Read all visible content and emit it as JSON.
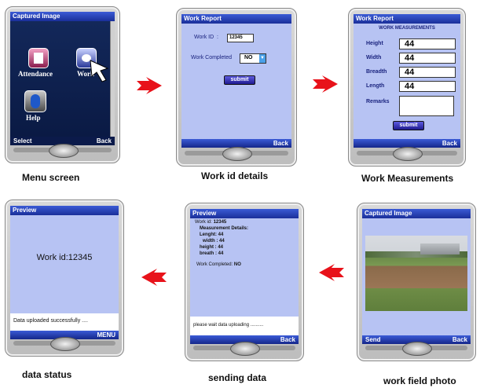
{
  "captions": {
    "menu": "Menu screen",
    "workid": "Work id details",
    "measure": "Work Measurements",
    "status": "data status",
    "sending": "sending data",
    "photo": "work field photo"
  },
  "menu_screen": {
    "title": "Captured Image",
    "items": [
      "Attendance",
      "Work",
      "Help"
    ],
    "left_softkey": "Select",
    "right_softkey": "Back"
  },
  "workid_screen": {
    "title": "Work Report",
    "work_id_label": "Work ID",
    "work_id_sep": ":",
    "work_id_value": "12345",
    "completed_label": "Work Completed",
    "completed_value": "NO",
    "submit": "submit",
    "right_softkey": "Back"
  },
  "measure_screen": {
    "title": "Work Report",
    "heading": "WORK MEASUREMENTS",
    "fields": [
      {
        "label": "Height",
        "value": "44"
      },
      {
        "label": "Width",
        "value": "44"
      },
      {
        "label": "Breadth",
        "value": "44"
      },
      {
        "label": "Length",
        "value": "44"
      }
    ],
    "remarks_label": "Remarks",
    "submit": "submit",
    "right_softkey": "Back"
  },
  "status_screen": {
    "title": "Preview",
    "work_id_text": "Work id:12345",
    "message": "Data uploaded successfully ....",
    "right_softkey": "MENU"
  },
  "sending_screen": {
    "title": "Preview",
    "work_id_label": "Work id:",
    "work_id_value": "12345",
    "details_heading": "Measurement Details:",
    "details": [
      "Lenght: 44",
      "width : 44",
      "height : 44",
      "breath : 44"
    ],
    "completed_label": "Work Completed:",
    "completed_value": "NO",
    "message": "please wait data uploading ..........",
    "right_softkey": "Back"
  },
  "photo_screen": {
    "title": "Captured Image",
    "left_softkey": "Send",
    "right_softkey": "Back"
  },
  "colors": {
    "accent": "#1a2f9a",
    "screen_bg": "#b7c3f3",
    "arrow": "#e8121a"
  },
  "icons": [
    "document-icon",
    "camera-icon",
    "help-icon",
    "pointer-cursor-icon",
    "right-arrow-icon",
    "left-arrow-icon",
    "dropdown-arrow-icon"
  ]
}
